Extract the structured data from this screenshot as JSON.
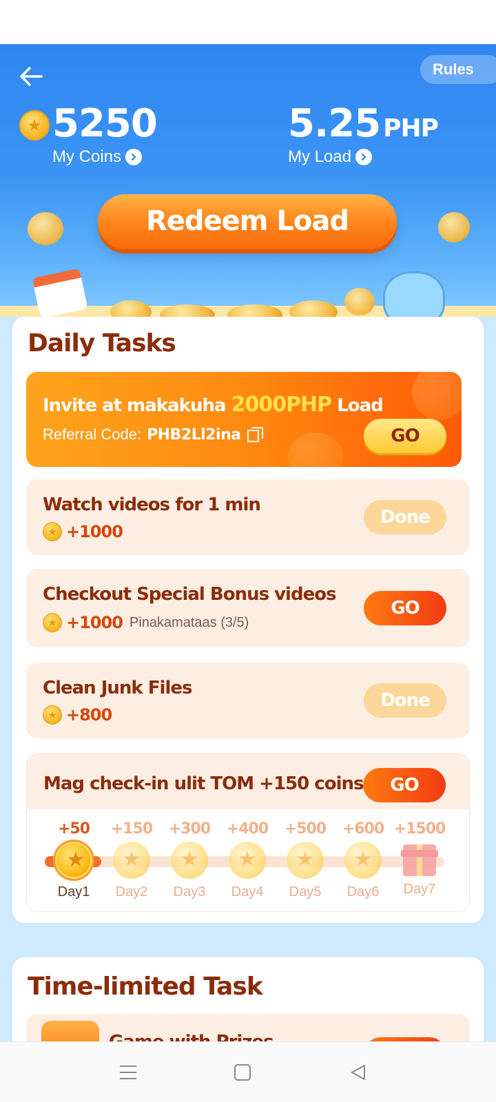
{
  "header": {
    "rules_label": "Rules",
    "coins_value": "5250",
    "coins_label": "My Coins",
    "load_value": "5.25",
    "load_unit": "PHP",
    "load_label": "My Load",
    "redeem_label": "Redeem Load"
  },
  "daily_tasks": {
    "title": "Daily Tasks",
    "invite": {
      "title_prefix": "Invite at makakuha ",
      "title_highlight": "2000PHP",
      "title_suffix": " Load",
      "code_label": "Referral Code:",
      "code_value": "PHB2Ll2ina",
      "button": "GO"
    },
    "tasks": [
      {
        "title": "Watch videos for 1 min",
        "reward": "+1000",
        "extra": "",
        "button": "Done"
      },
      {
        "title": "Checkout Special Bonus videos",
        "reward": "+1000",
        "extra": "Pinakamataas (3/5)",
        "button": "GO"
      },
      {
        "title": "Clean Junk Files",
        "reward": "+800",
        "extra": "",
        "button": "Done"
      }
    ],
    "checkin": {
      "title": "Mag check-in ulit TOM +150 coins",
      "button": "GO",
      "days": [
        {
          "bonus": "+50",
          "label": "Day1"
        },
        {
          "bonus": "+150",
          "label": "Day2"
        },
        {
          "bonus": "+300",
          "label": "Day3"
        },
        {
          "bonus": "+400",
          "label": "Day4"
        },
        {
          "bonus": "+500",
          "label": "Day5"
        },
        {
          "bonus": "+600",
          "label": "Day6"
        },
        {
          "bonus": "+1500",
          "label": "Day7"
        }
      ]
    }
  },
  "time_limited": {
    "title": "Time-limited Task",
    "partial_item_title": "Game with Prizes"
  },
  "colors": {
    "header_blue": "#2f86f0",
    "title_brown": "#8b2c0a",
    "accent_orange": "#ff7a12",
    "panel_bg": "#cfeaff"
  }
}
